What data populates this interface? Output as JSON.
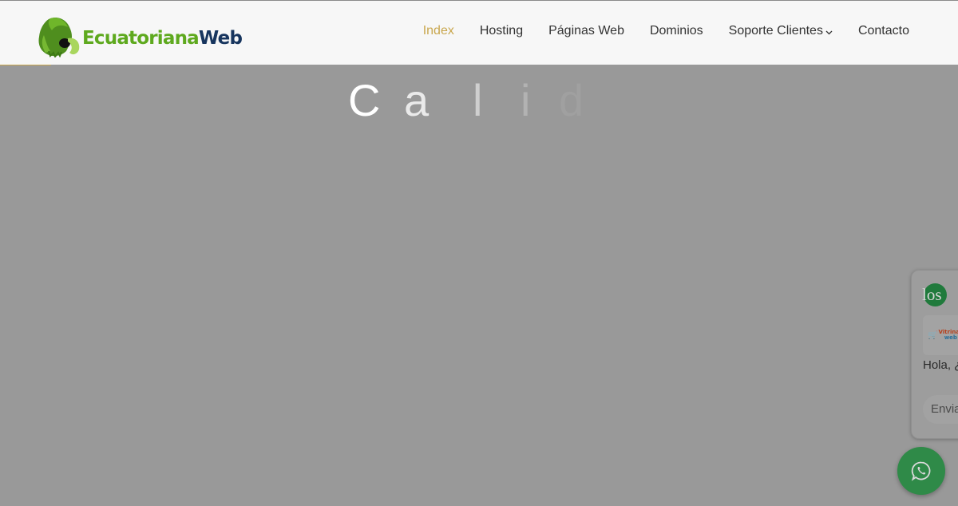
{
  "header": {
    "logo": {
      "text_part1": "Ecuatoriana",
      "text_part2": "Web",
      "icon": "parrot-logo-icon",
      "colors": {
        "green": "#5ea91e",
        "navy": "#17355e"
      }
    },
    "nav": {
      "items": [
        {
          "label": "Index",
          "active": true
        },
        {
          "label": "Hosting",
          "active": false
        },
        {
          "label": "Páginas Web",
          "active": false
        },
        {
          "label": "Dominios",
          "active": false
        },
        {
          "label": "Soporte Clientes",
          "active": false,
          "has_dropdown": true,
          "dropdown_icon": "chevron-down-icon"
        },
        {
          "label": "Contacto",
          "active": false
        }
      ],
      "active_color": "#c9a74e"
    }
  },
  "hero": {
    "letters": [
      "C",
      "a",
      "l",
      "i",
      "d"
    ]
  },
  "chat_widget": {
    "avatar_text": "los",
    "brand_line1": "Vitrinas",
    "brand_line2": "web",
    "greeting": "Hola, ¿",
    "send_label": "Envia",
    "whatsapp_icon": "whatsapp-icon",
    "whatsapp_color": "#2f8a48"
  }
}
